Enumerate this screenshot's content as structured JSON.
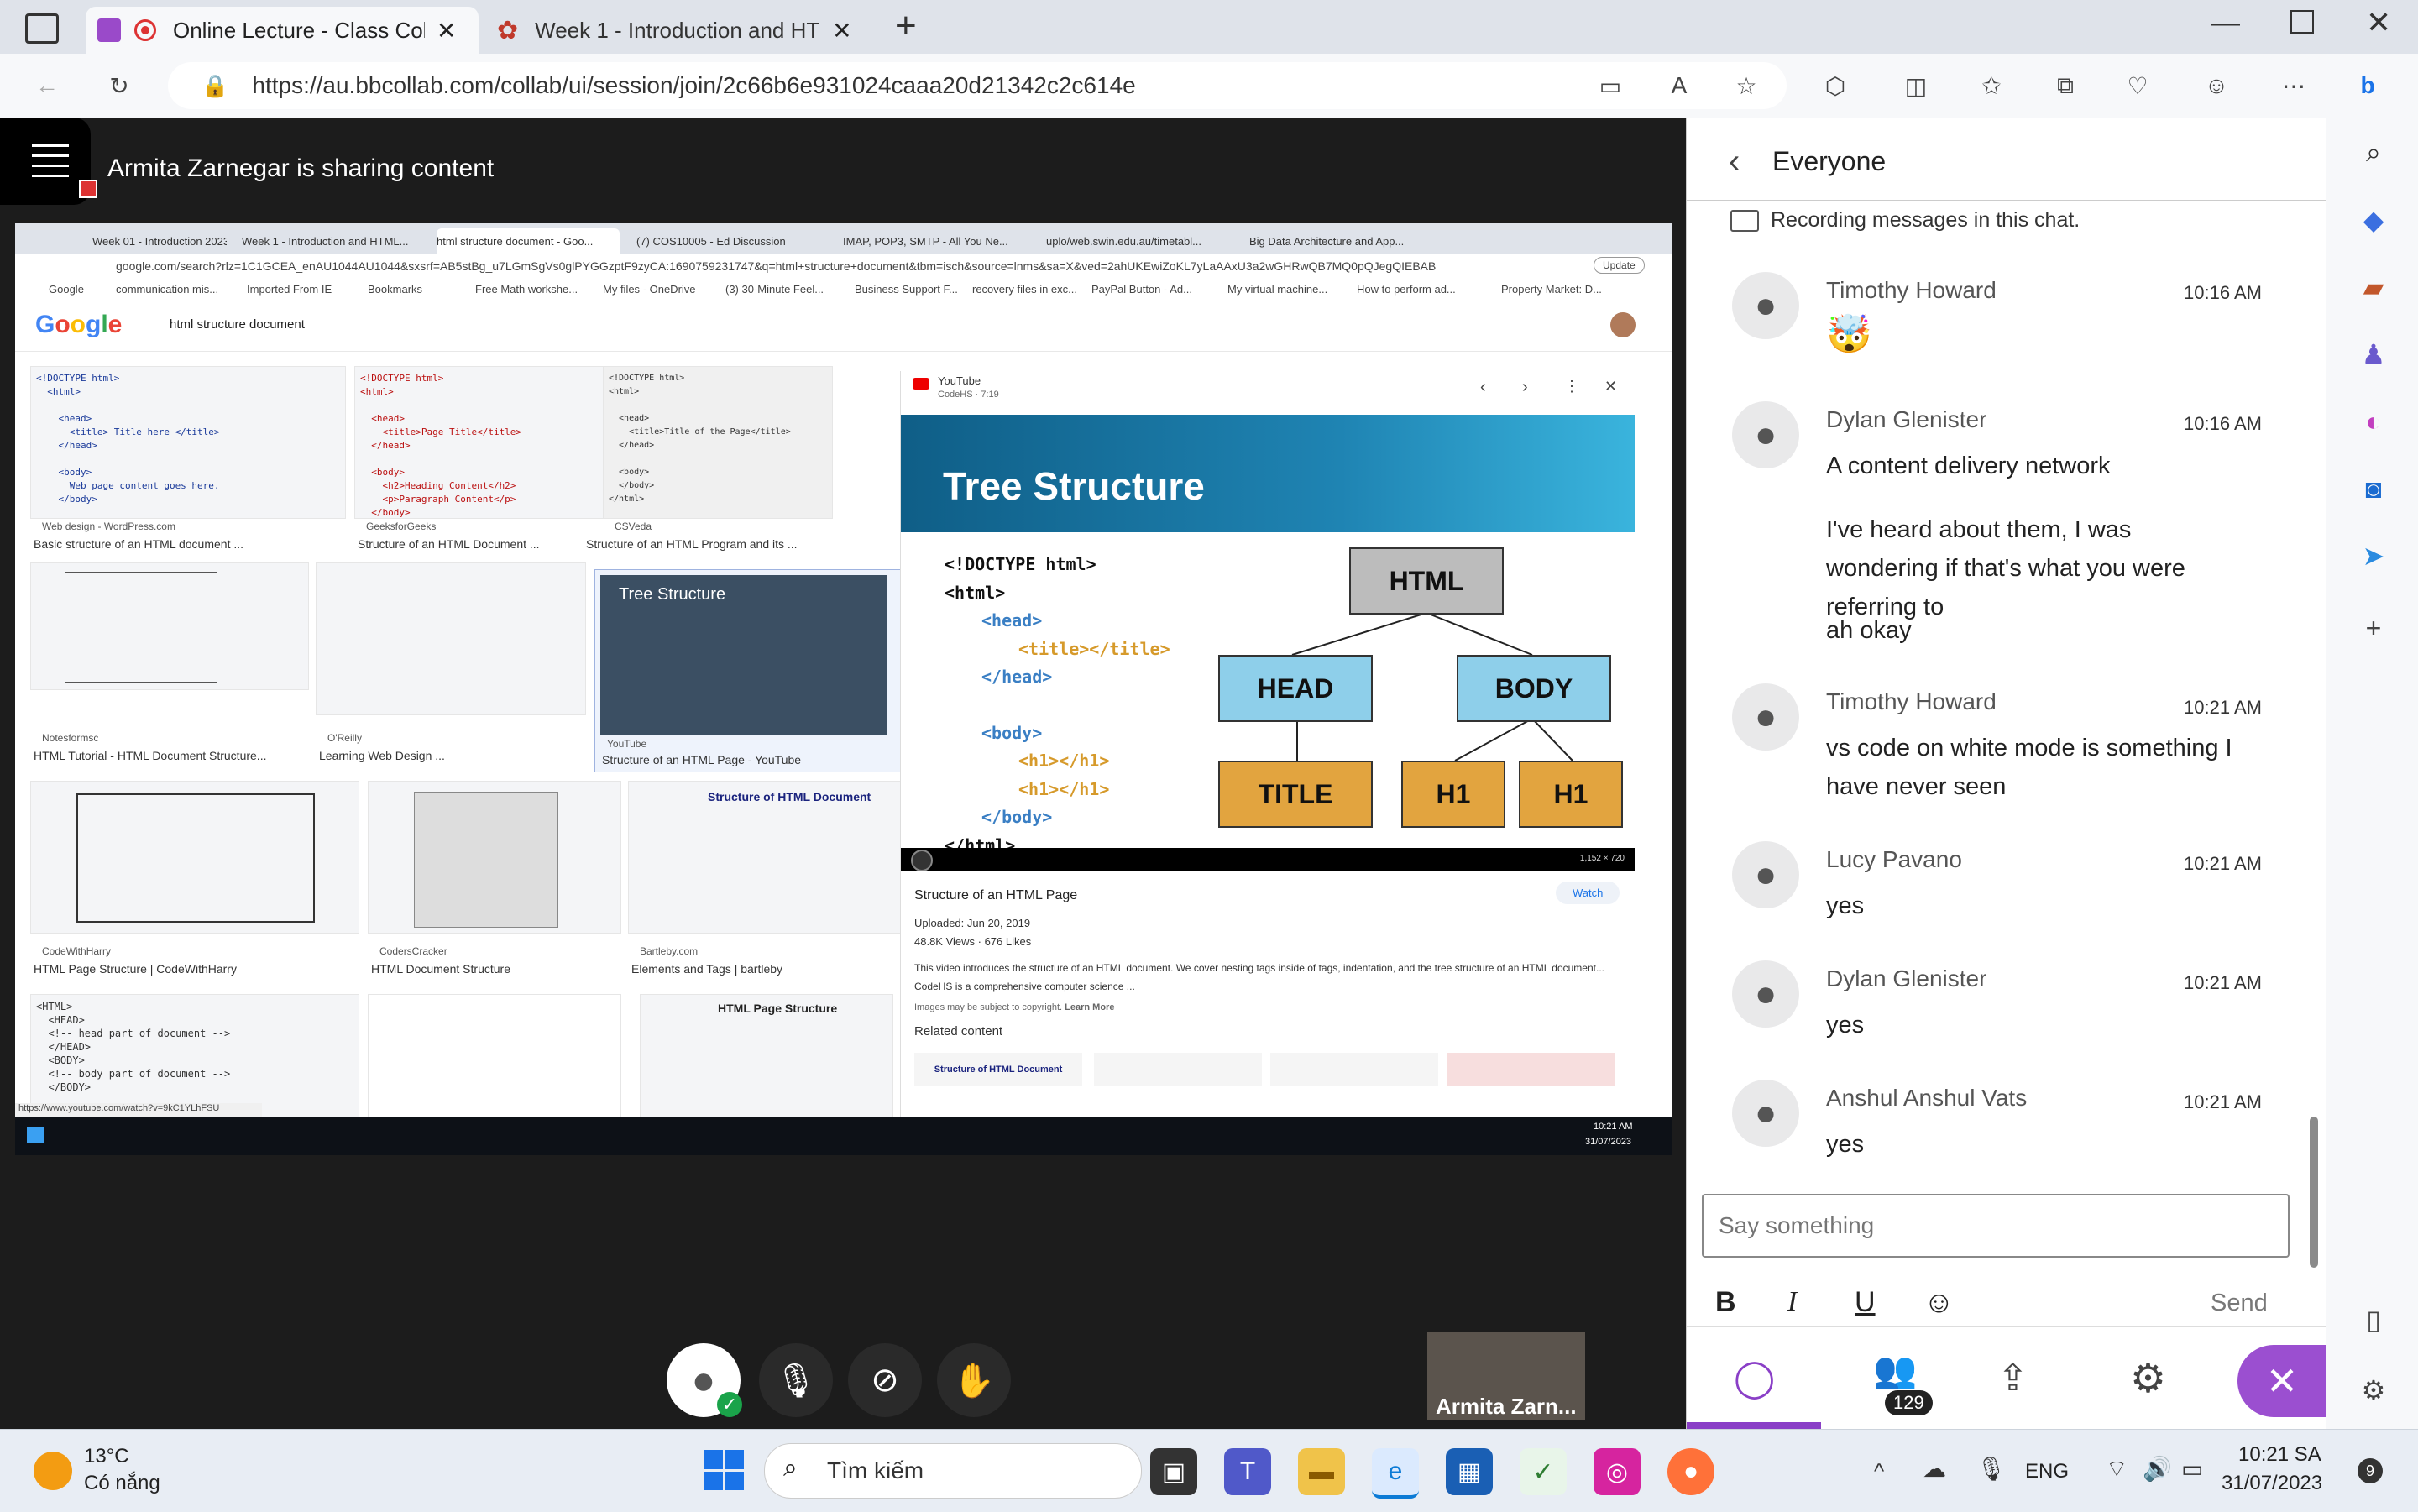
{
  "browser": {
    "tabs": [
      {
        "label": "Online Lecture - Class Collal",
        "active": true
      },
      {
        "label": "Week 1 - Introduction and HTML",
        "active": false
      }
    ],
    "url": "https://au.bbcollab.com/collab/ui/session/join/2c66b6e931024caaa20d21342c2c614e"
  },
  "stage": {
    "share_text": "Armita Zarnegar is sharing content",
    "presenter_label": "Armita Zarn..."
  },
  "shared_screen": {
    "inner_tabs": [
      "Week 01 - Introduction 2023...",
      "Week 1 - Introduction and HTML...",
      "html structure document - Goo...",
      "(7) COS10005 - Ed Discussion",
      "IMAP, POP3, SMTP - All You Ne...",
      "uplo/web.swin.edu.au/timetabl...",
      "Big Data Architecture and App..."
    ],
    "inner_url": "google.com/search?rlz=1C1GCEA_enAU1044AU1044&sxsrf=AB5stBg_u7LGmSgVs0glPYGGzptF9zyCA:1690759231747&q=html+structure+document&tbm=isch&source=lnms&sa=X&ved=2ahUKEwiZoKL7yLaAAxU3a2wGHRwQB7MQ0pQJegQIEBAB",
    "update_label": "Update",
    "bookmarks": [
      "Google",
      "communication mis...",
      "Imported From IE",
      "Bookmarks",
      "Free Math workshe...",
      "My files - OneDrive",
      "(3) 30-Minute Feel...",
      "Business Support F...",
      "recovery files in exc...",
      "PayPal Button - Ad...",
      "My virtual machine...",
      "How to perform ad...",
      "Property Market: D..."
    ],
    "search_query": "html structure document",
    "results": [
      {
        "source": "Web design - WordPress.com",
        "title": "Basic structure of an HTML document ..."
      },
      {
        "source": "GeeksforGeeks",
        "title": "Structure of an HTML Document ..."
      },
      {
        "source": "CSVeda",
        "title": "Structure of an HTML Program and its ..."
      },
      {
        "source": "Notesformsc",
        "title": "HTML Tutorial - HTML Document Structure..."
      },
      {
        "source": "O'Reilly",
        "title": "Learning Web Design ..."
      },
      {
        "source": "YouTube",
        "title": "Structure of an HTML Page - YouTube"
      },
      {
        "source": "CodeWithHarry",
        "title": "HTML Page Structure | CodeWithHarry"
      },
      {
        "source": "CodersCracker",
        "title": "HTML Document Structure"
      },
      {
        "source": "Bartleby.com",
        "title": "Elements and Tags | bartleby"
      }
    ],
    "thumb_text": {
      "t1": "<!DOCTYPE html>\n  <html>\n\n    <head>\n      <title> Title here </title>\n    </head>\n\n    <body>\n      Web page content goes here.\n    </body>\n\n  </html>",
      "t2": "<!DOCTYPE html>\n<html>\n\n  <head>\n    <title>Page Title</title>\n  </head>\n\n  <body>\n    <h2>Heading Content</h2>\n    <p>Paragraph Content</p>\n  </body>\n</html>",
      "t3": "<!DOCTYPE html>\n<html>\n\n  <head>\n    <title>Title of the Page</title>\n  </head>\n\n  <body>\n  </body>\n</html>",
      "t10": "<HTML>\n  <HEAD>\n  <!-- head part of document -->\n  </HEAD>\n  <BODY>\n  <!-- body part of document -->\n  </BODY>",
      "t11_title": "Structure of HTML Document",
      "t12_title": "HTML Page Structure",
      "t6_title": "Tree Structure"
    },
    "youtube": {
      "site": "YouTube",
      "channel": "CodeHS · 7:19",
      "banner_title": "Tree Structure",
      "code_lines": [
        "<!DOCTYPE html>",
        "<html>",
        "<head>",
        "<title></title>",
        "</head>",
        "<body>",
        "<h1></h1>",
        "<h1></h1>",
        "</body>",
        "</html>"
      ],
      "tree": {
        "root": "HTML",
        "head": "HEAD",
        "body": "BODY",
        "title": "TITLE",
        "h1a": "H1",
        "h1b": "H1"
      },
      "resolution": "1,152 × 720",
      "video_title": "Structure of an HTML Page",
      "watch_label": "Watch",
      "uploaded": "Uploaded: Jun 20, 2019",
      "stats": "48.8K Views · 676 Likes",
      "description": "This video introduces the structure of an HTML document. We cover nesting tags inside of tags, indentation, and the tree structure of an HTML document... CodeHS is a comprehensive computer science ...",
      "copyright": "Images may be subject to copyright.",
      "learn_more": "Learn More",
      "related": "Related content",
      "related_thumb": "Structure of HTML Document"
    },
    "status_url": "https://www.youtube.com/watch?v=9kC1YLhFSU",
    "taskbar_time": "10:21 AM",
    "taskbar_date": "31/07/2023"
  },
  "chat": {
    "header": "Everyone",
    "recording_notice": "Recording messages in this chat.",
    "messages": [
      {
        "name": "Timothy Howard",
        "time": "10:16 AM",
        "lines": [
          "🤯"
        ]
      },
      {
        "name": "Dylan Glenister",
        "time": "10:16 AM",
        "lines": [
          "A content delivery network",
          "I've heard about them, I was wondering if that's what you were referring to",
          "ah okay"
        ]
      },
      {
        "name": "Timothy Howard",
        "time": "10:21 AM",
        "lines": [
          "vs code on white mode is something I have never seen"
        ]
      },
      {
        "name": "Lucy Pavano",
        "time": "10:21 AM",
        "lines": [
          "yes"
        ]
      },
      {
        "name": "Dylan Glenister",
        "time": "10:21 AM",
        "lines": [
          "yes"
        ]
      },
      {
        "name": "Anshul Anshul Vats",
        "time": "10:21 AM",
        "lines": [
          "yes"
        ]
      }
    ],
    "input_placeholder": "Say something",
    "send_label": "Send",
    "participants_count": "129"
  },
  "taskbar": {
    "weather_temp": "13°C",
    "weather_desc": "Có nắng",
    "search_placeholder": "Tìm kiếm",
    "lang": "ENG",
    "time": "10:21 SA",
    "date": "31/07/2023",
    "notif_count": "9"
  },
  "colors": {
    "accent": "#8a3fc7",
    "chat_close": "#9b4fd0",
    "stage_bg": "#1c1c1c"
  }
}
